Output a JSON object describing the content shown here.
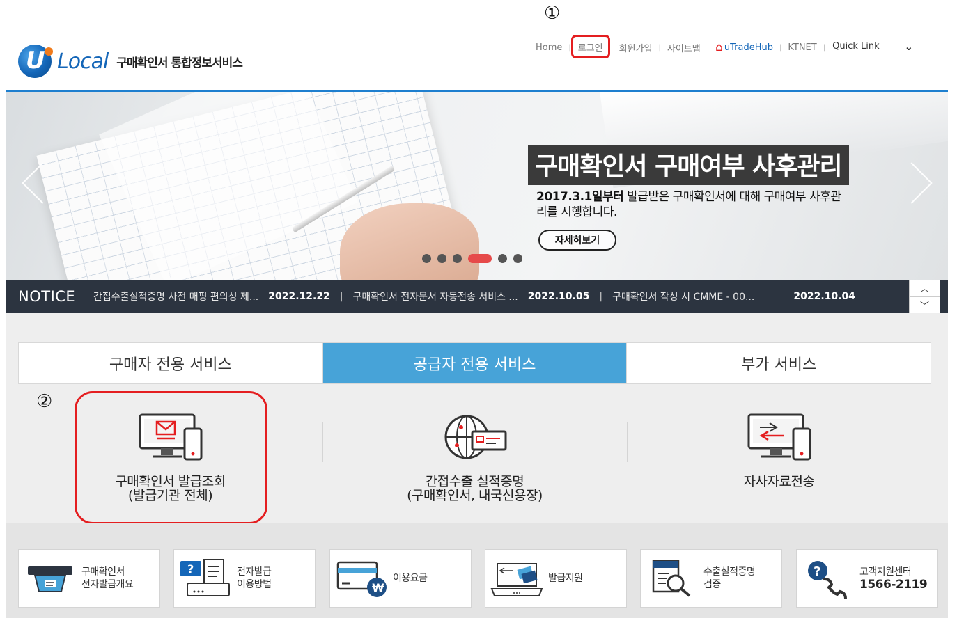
{
  "header": {
    "logo_word": "Local",
    "logo_sub": "구매확인서 통합정보서비스",
    "nav": {
      "home": "Home",
      "login": "로그인",
      "signup": "회원가입",
      "sitemap": "사이트맵",
      "utradehub": "uTradeHub",
      "ktnet": "KTNET",
      "quicklink": "Quick Link"
    },
    "annotation_1": "①"
  },
  "banner": {
    "title": "구매확인서 구매여부 사후관리",
    "desc_bold": "2017.3.1일부터",
    "desc_rest": " 발급받은 구매확인서에 대해 구매여부 사후관리를 시행합니다.",
    "detail_button": "자세히보기",
    "slides_total": 6,
    "slide_active_index": 3
  },
  "notice": {
    "label": "NOTICE",
    "items": [
      {
        "title": "간접수출실적증명 사전 매핑 편의성 제...",
        "date": "2022.12.22"
      },
      {
        "title": "구매확인서 전자문서 자동전송 서비스 ...",
        "date": "2022.10.05"
      },
      {
        "title": "구매확인서 작성 시 CMME - 00...",
        "date": "2022.10.04"
      }
    ],
    "up": "^",
    "down": "v"
  },
  "services": {
    "tabs": [
      "구매자 전용 서비스",
      "공급자 전용 서비스",
      "부가 서비스"
    ],
    "active_tab": 1,
    "annotation_2": "②",
    "items": [
      {
        "line1": "구매확인서 발급조회",
        "line2": "(발급기관 전체)",
        "icon": "monitor-mail-icon"
      },
      {
        "line1": "간접수출 실적증명",
        "line2": "(구매확인서, 내국신용장)",
        "icon": "globe-card-icon"
      },
      {
        "line1": "자사자료전송",
        "line2": "",
        "icon": "monitor-transfer-icon"
      }
    ]
  },
  "quick_menu": [
    {
      "line1": "구매확인서",
      "line2": "전자발급개요",
      "icon": "card-terminal-icon"
    },
    {
      "line1": "전자발급",
      "line2": "이용방법",
      "icon": "help-document-icon"
    },
    {
      "line1": "이용요금",
      "line2": "",
      "icon": "won-card-icon"
    },
    {
      "line1": "발급지원",
      "line2": "",
      "icon": "laptop-transfer-icon"
    },
    {
      "line1": "수출실적증명",
      "line2": "검증",
      "icon": "document-search-icon"
    },
    {
      "line1": "고객지원센터",
      "line2": "1566-2119",
      "icon": "phone-help-icon"
    }
  ],
  "colors": {
    "brand_blue": "#1466b8",
    "active_tab": "#47a3d8",
    "notice_bg": "#2c3440",
    "highlight_red": "#e41e20",
    "active_dot": "#e64a4a"
  }
}
